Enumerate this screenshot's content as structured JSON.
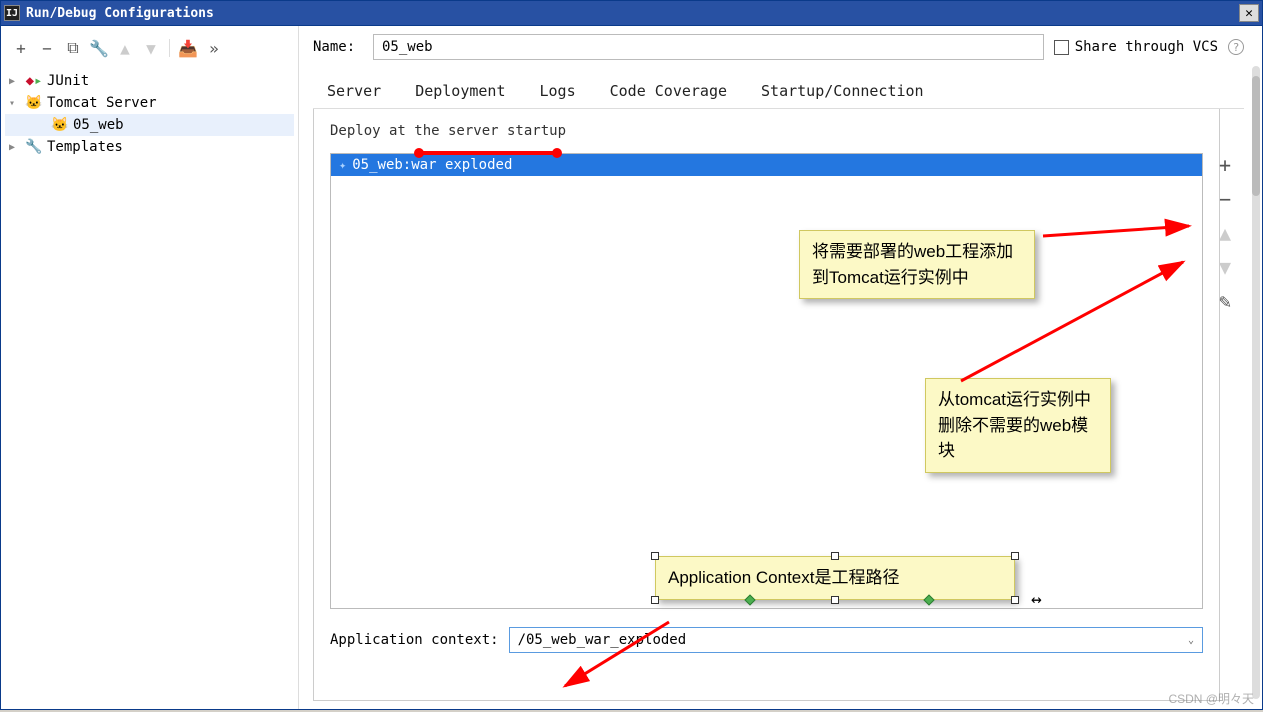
{
  "title": "Run/Debug Configurations",
  "toolbar": {
    "add": "+",
    "remove": "−",
    "copy": "⧉",
    "wrench": "🔧",
    "up": "▲",
    "down": "▼",
    "folder": "📁",
    "expand": "»"
  },
  "tree": {
    "junit": "JUnit",
    "tomcat": "Tomcat Server",
    "tomcat_child": "05_web",
    "templates": "Templates"
  },
  "name_label": "Name:",
  "name_value": "05_web",
  "share_label": "Share through VCS",
  "help": "?",
  "tabs": {
    "server": "Server",
    "deployment": "Deployment",
    "logs": "Logs",
    "code_coverage": "Code Coverage",
    "startup": "Startup/Connection"
  },
  "deploy_label": "Deploy at the server startup",
  "artifact": "05_web:war exploded",
  "side": {
    "add": "+",
    "remove": "−",
    "up": "▲",
    "down": "▼",
    "edit": "✎"
  },
  "app_context_label": "Application context:",
  "app_context_value": "/05_web_war_exploded",
  "notes": {
    "n1": "将需要部署的web工程添加到Tomcat运行实例中",
    "n2": "从tomcat运行实例中删除不需要的web模块",
    "n3": "Application Context是工程路径"
  },
  "watermark": "CSDN @明々天"
}
